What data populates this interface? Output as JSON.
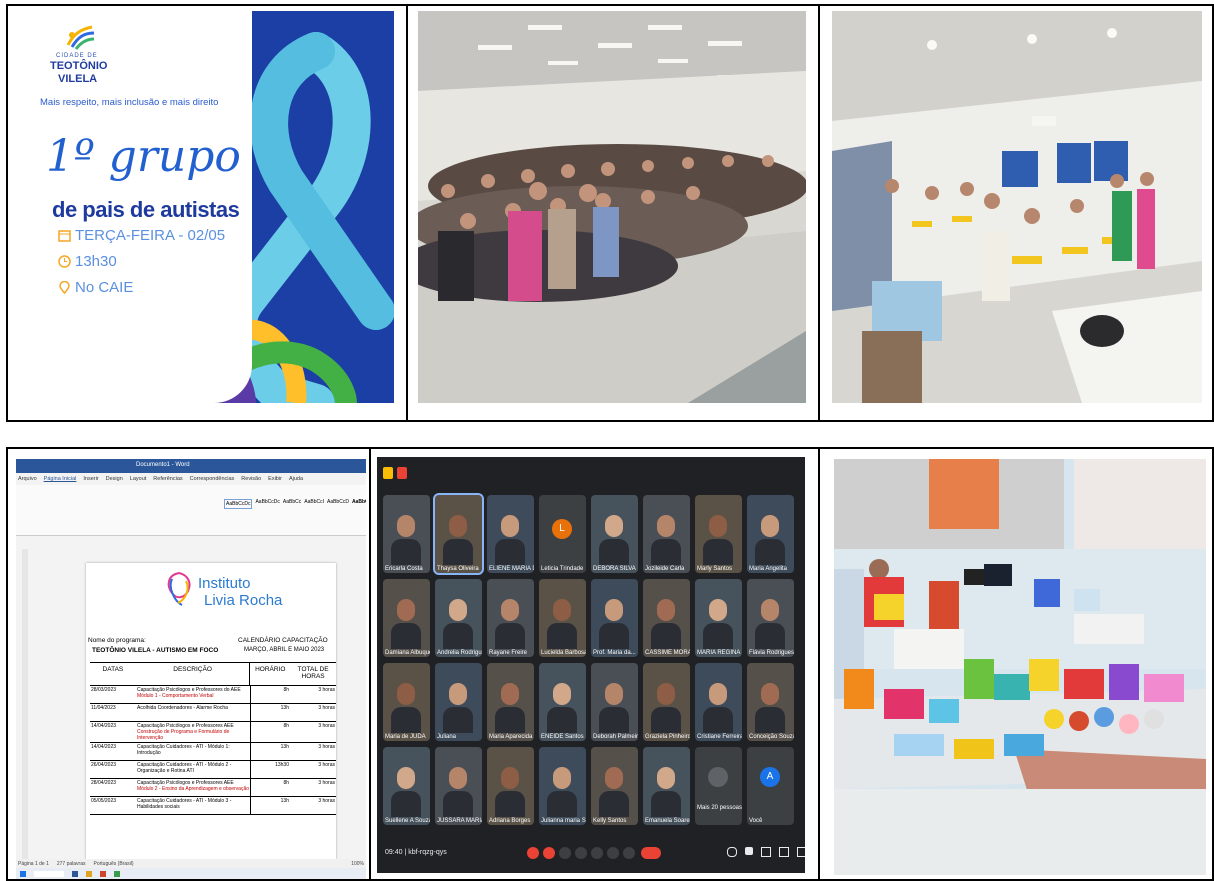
{
  "flyer": {
    "city_prefix": "CIDADE DE",
    "city_line1": "TEOTÔNIO",
    "city_line2": "VILELA",
    "slogan": "Mais respeito, mais inclusão e mais direito",
    "headline_script": "1º grupo",
    "headline_bold": "de pais de autistas",
    "date_line": "TERÇA-FEIRA - 02/05",
    "time_line": "13h30",
    "place_line": "No CAIE",
    "colors": {
      "background": "#1b3fa5",
      "ribbon": "#6ccde8",
      "accent": "#2260d0"
    }
  },
  "document": {
    "app_title": "Documento1 - Word",
    "ribbon_tabs": [
      "Arquivo",
      "Página Inicial",
      "Inserir",
      "Design",
      "Layout",
      "Referências",
      "Correspondências",
      "Revisão",
      "Exibir",
      "Ajuda"
    ],
    "styles": [
      "AaBbCcDc",
      "AaBbCcDc",
      "AaBbCc",
      "AaBbCcI",
      "AaBbCcD",
      "AaBbCcI"
    ],
    "institute_line1": "Instituto",
    "institute_line2": "Livia Rocha",
    "form_name_label": "Nome do programa:",
    "program_name": "TEOTÔNIO VILELA - AUTISMO EM FOCO",
    "calendar_title": "CALENDÁRIO CAPACITAÇÃO",
    "calendar_subtitle": "MARÇO, ABRIL E MAIO 2023",
    "table_headers": [
      "DATAS",
      "DESCRIÇÃO",
      "HORÁRIO",
      "TOTAL DE HORAS"
    ],
    "rows": [
      {
        "date": "28/03/2023",
        "desc": "Capacitação Psicólogos e Professores do AEE",
        "sub": "Módulo 1 - Comportamento Verbal",
        "time": "8h",
        "hours": "3 horas"
      },
      {
        "date": "11/04/2023",
        "desc": "Acolhida Coordenadores - Alarme Rocha",
        "sub": "",
        "time": "13h",
        "hours": "3 horas"
      },
      {
        "date": "14/04/2023",
        "desc": "Capacitação Psicólogos e Professores AEE",
        "sub": "Construção de Programa e Formulário de Intervenção",
        "time": "8h",
        "hours": "3 horas"
      },
      {
        "date": "14/04/2023",
        "desc": "Capacitação Cuidadores - ATI - Módulo 1: Introdução",
        "sub": "",
        "time": "13h",
        "hours": "3 horas"
      },
      {
        "date": "26/04/2023",
        "desc": "Capacitação Cuidadores - ATI - Módulo 2 - Organização e Rotina ATI",
        "sub": "",
        "time": "13h30",
        "hours": "3 horas"
      },
      {
        "date": "28/04/2023",
        "desc": "Capacitação Psicólogos e Professores AEE",
        "sub": "Módulo 2 - Ensino da Aprendizagem e observação",
        "time": "8h",
        "hours": "3 horas"
      },
      {
        "date": "05/05/2023",
        "desc": "Capacitação Cuidadores - ATI - Módulo 3 - Habilidades sociais",
        "sub": "",
        "time": "13h",
        "hours": "3 horas"
      }
    ],
    "status_page": "Página 1 de 1",
    "status_words": "277 palavras",
    "status_lang": "Português (Brasil)",
    "zoom": "100%"
  },
  "meeting": {
    "participants": [
      "Ericarla Costa",
      "Thaysa Oliveira",
      "ELIENE MARIA DE...",
      "Leticia Trindade",
      "DEBORA SILVA",
      "Jozileide Carla",
      "Marly Santos",
      "Maria Angelita",
      "Damiana Albuquerque",
      "Andrelia Rodrigues",
      "Rayane Freire",
      "Lucielda Barbosa",
      "Prof. Maria da...",
      "CASSIME MORAES",
      "MARIA REGINA",
      "Flávia Rodrigues",
      "Maria de JUDA",
      "Juliana",
      "Maria Aparecida",
      "ENEIDE Santos",
      "Deborah Palmeira",
      "Graziela Pinheiro",
      "Cristiane Ferreira",
      "Conceição Souza",
      "Suellene A Souza",
      "JUSSARA MARIA",
      "Adriana Borges",
      "Julianna maria Sant",
      "Kelly Santos",
      "Emanuela Soares"
    ],
    "more_label": "Mais 20 pessoas",
    "you_label": "Você",
    "you_initial": "A",
    "letter_avatar": "L",
    "meeting_code": "09:40 | kbf-rqzg-qys",
    "colors": {
      "end_call": "#ea4335",
      "bg": "#202124",
      "avatar_blue": "#1a73e8",
      "avatar_orange": "#e8710a"
    }
  }
}
